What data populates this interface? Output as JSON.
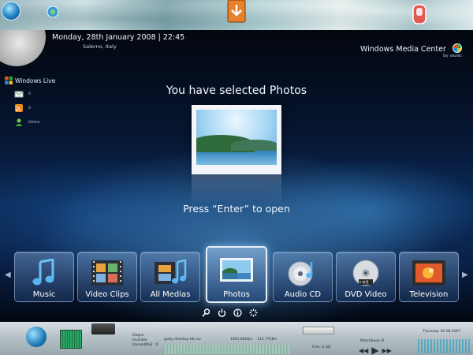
{
  "desktop": {
    "icons": [
      "start-orb-icon",
      "messenger-icon",
      "download-arrow-icon",
      "gadget-icon"
    ]
  },
  "media_center": {
    "datetime": "Monday, 28th January 2008 | 22:45",
    "location": "Salerno, Italy",
    "brand": {
      "name": "Windows Media Center",
      "sub": "by sazac"
    },
    "windows_live": {
      "title": "Windows Live",
      "rows": [
        {
          "icon": "mail-icon",
          "value": "0"
        },
        {
          "icon": "rss-icon",
          "value": "0"
        },
        {
          "icon": "contact-icon",
          "value": "Online"
        }
      ]
    },
    "selected_heading": "You have selected Photos",
    "open_hint": "Press “Enter” to open",
    "media_items": [
      {
        "label": "Music",
        "icon": "music-note-icon",
        "selected": false
      },
      {
        "label": "Video Clips",
        "icon": "film-strip-icon",
        "selected": false
      },
      {
        "label": "All Medias",
        "icon": "all-media-icon",
        "selected": false
      },
      {
        "label": "Photos",
        "icon": "photo-icon",
        "selected": true
      },
      {
        "label": "Audio CD",
        "icon": "audio-cd-icon",
        "selected": false
      },
      {
        "label": "DVD Video",
        "icon": "dvd-icon",
        "selected": false
      },
      {
        "label": "Television",
        "icon": "television-icon",
        "selected": false
      }
    ],
    "transport_icons": [
      "settings-wrench-icon",
      "power-icon",
      "info-icon",
      "loading-icon"
    ],
    "accent": "#6fb8f0"
  },
  "taskbar": {
    "msg_status": [
      "Daghe",
      "Invisible",
      "UnreadMail : 0"
    ],
    "file_name": "gotty-desktop-tilt.iso",
    "dl_speed": "1601.88kB/s",
    "ul_speed": "214.77kB/s",
    "free_space": "Free: 2 GB",
    "track": "Matchbook III",
    "date": "Thursday 30-08-2007"
  }
}
